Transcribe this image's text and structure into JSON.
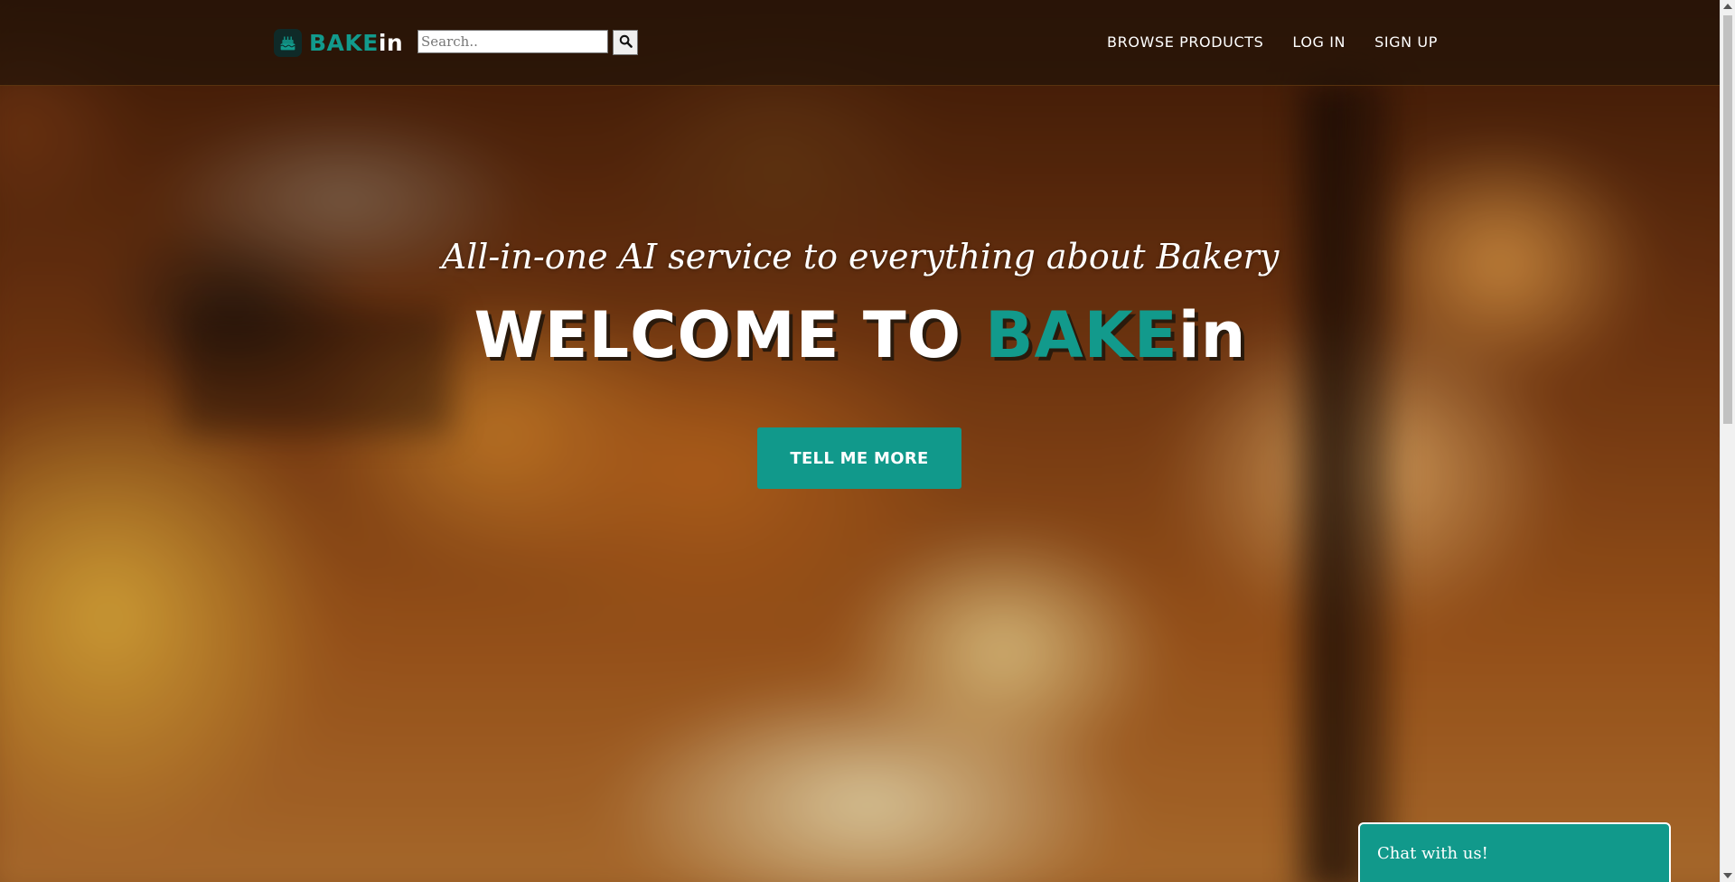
{
  "nav": {
    "brand": {
      "part1": "BAKE",
      "part2": "in",
      "logo_icon": "cake-icon"
    },
    "search": {
      "placeholder": "Search..",
      "value": "",
      "button_icon": "search-icon"
    },
    "links": [
      "BROWSE PRODUCTS",
      "LOG IN",
      "SIGN UP"
    ]
  },
  "hero": {
    "subtitle": "All-in-one AI service to everything about Bakery",
    "heading_prefix": "WELCOME TO",
    "heading_brand_1": "BAKE",
    "heading_brand_2": "in",
    "cta_label": "TELL ME MORE"
  },
  "chat": {
    "label": "Chat with us!"
  },
  "colors": {
    "accent": "#11998b",
    "text_on_dark": "#ffffff"
  }
}
